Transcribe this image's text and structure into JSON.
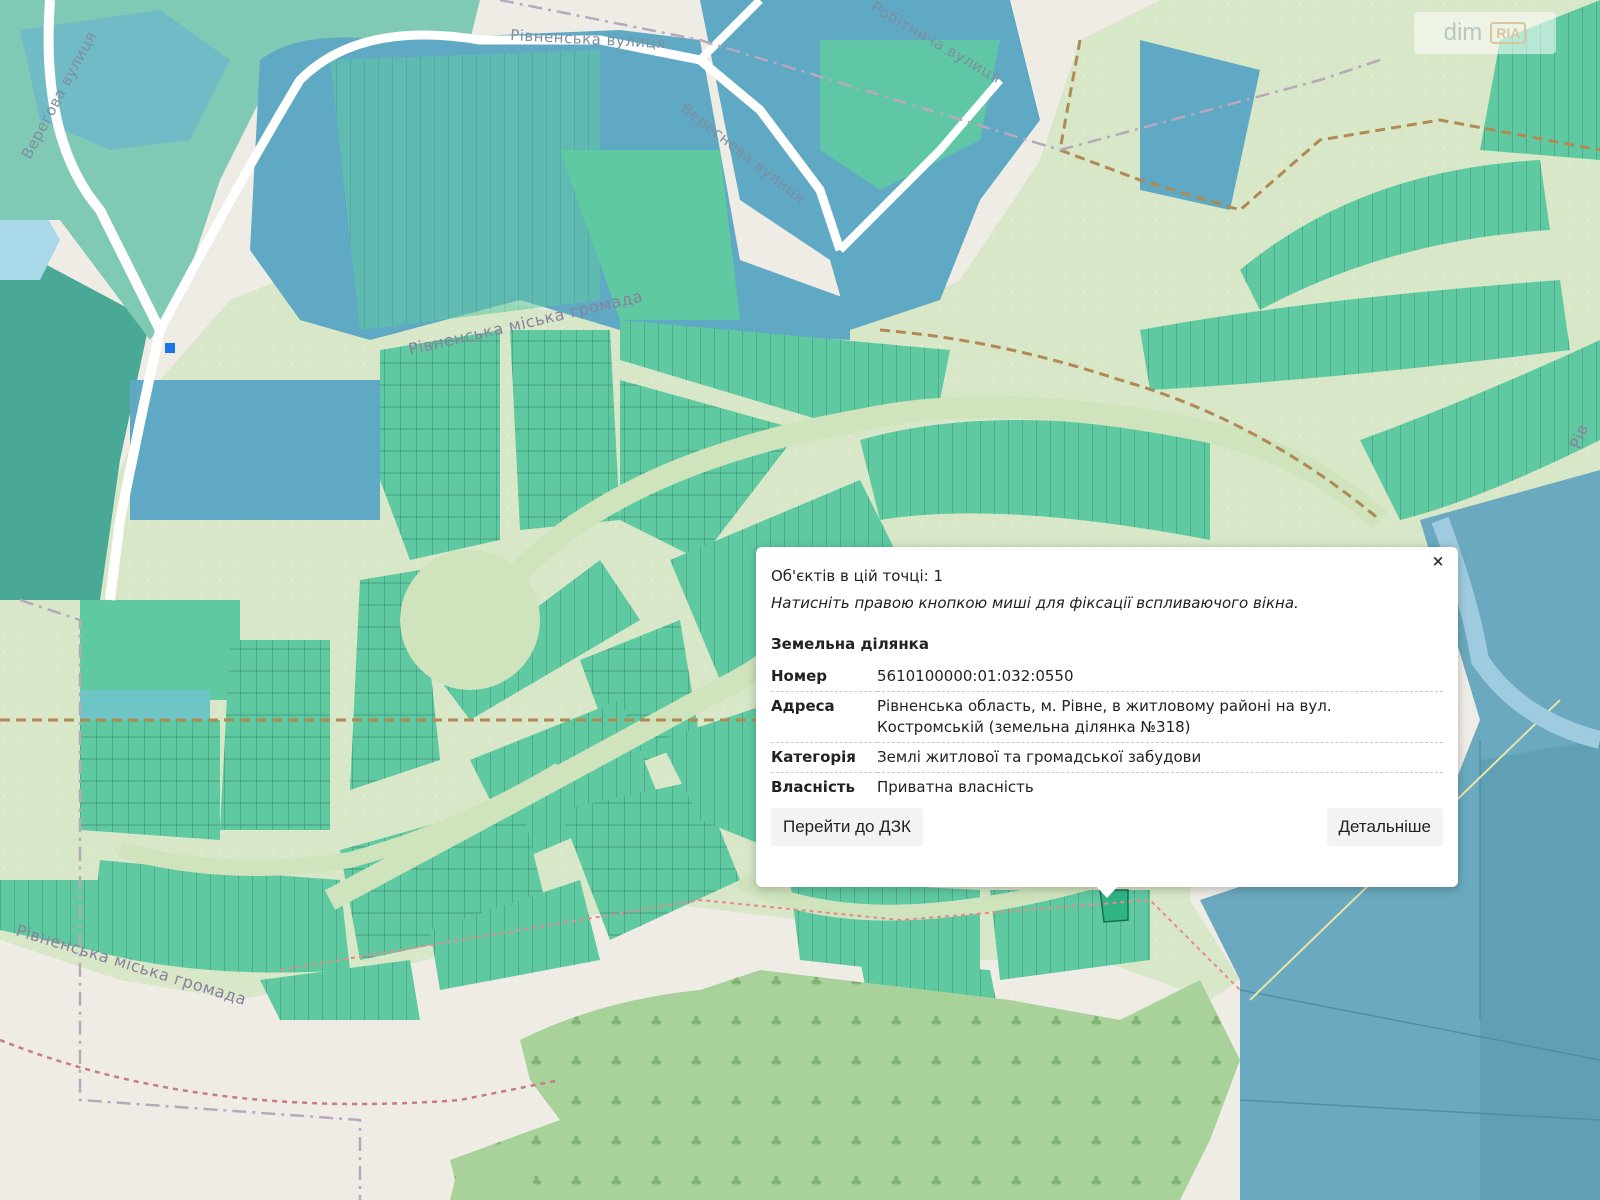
{
  "map": {
    "streets": [
      {
        "id": "rivnenska-street",
        "label": "Рівненська вулиця"
      },
      {
        "id": "veresova-street",
        "label": "Верегова вулиця"
      },
      {
        "id": "robitnycha-street",
        "label": "Робітнича вулиця"
      },
      {
        "id": "veresneva-street",
        "label": "Вереснева вулиця"
      }
    ],
    "community_labels": [
      {
        "id": "community-label-top",
        "label": "Рівненська міська громада"
      },
      {
        "id": "community-label-bottom",
        "label": "Рівненська міська громада"
      },
      {
        "id": "community-label-right",
        "label": "Рів"
      }
    ],
    "colors": {
      "background": "#efece6",
      "meadow": "#d7e7c8",
      "parcel_residential": "#5fcaa2",
      "parcel_blue": "#5fa9c4",
      "parcel_dark": "#4aa896",
      "forest": "#a9d29b",
      "road": "#ffffff",
      "boundary_dash": "#b08a52",
      "selected_parcel": "#2fb584"
    }
  },
  "watermark": {
    "text": "dim",
    "brand": "RIA"
  },
  "popup": {
    "objects_count_text": "Об'єктів в цій точці: 1",
    "hint": "Натисніть правою кнопкою миші для фіксації вспливаючого вікна.",
    "close_label": "×",
    "section_title": "Земельна ділянка",
    "rows": [
      {
        "key": "Номер",
        "value": "5610100000:01:032:0550"
      },
      {
        "key": "Адреса",
        "value": "Рівненська область, м. Рівне, в житловому районі на вул. Костромській (земельна ділянка №318)"
      },
      {
        "key": "Категорія",
        "value": "Землі житлової та громадської забудови"
      },
      {
        "key": "Власність",
        "value": "Приватна власність"
      }
    ],
    "actions": {
      "left": "Перейти до ДЗК",
      "right": "Детальніше"
    }
  }
}
